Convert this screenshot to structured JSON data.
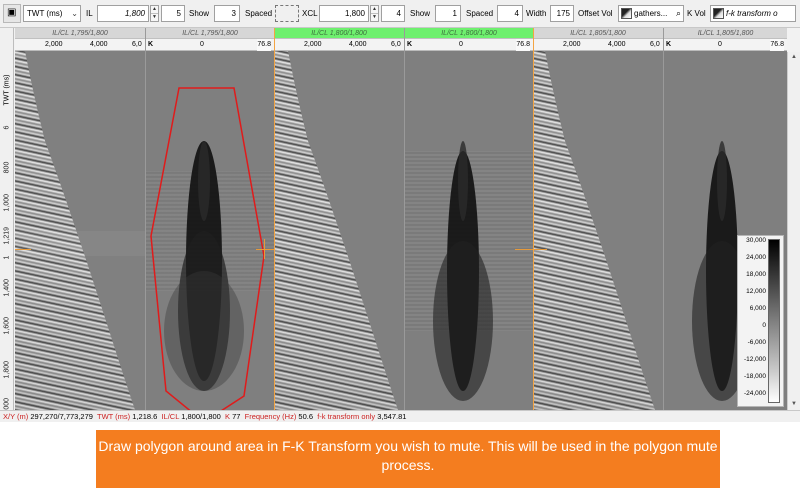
{
  "toolbar": {
    "domain_select": "TWT (ms)",
    "il_label": "IL",
    "il_value": "1,800",
    "il_step": "5",
    "show1_label": "Show",
    "show1_value": "3",
    "spaced1_label": "Spaced",
    "xcl_label": "XCL",
    "xcl_value": "1,800",
    "xcl_step": "4",
    "show2_label": "Show",
    "show2_value": "1",
    "spaced2_label": "Spaced",
    "spaced2_value": "4",
    "width_label": "Width",
    "width_value": "175",
    "offset_vol_label": "Offset Vol",
    "offset_vol_value": "gathers...",
    "k_vol_label": "K Vol",
    "k_vol_value": "f-k transform o"
  },
  "y_axis": {
    "title": "TWT (ms)",
    "ticks": [
      "6",
      "800",
      "1,000",
      "1,219",
      "1",
      "1,400",
      "1,600",
      "1,800",
      "2,000"
    ]
  },
  "panels": [
    {
      "header": "IL/CL 1,795/1,800",
      "ticks": [
        "2,000",
        "4,000",
        "6,0"
      ],
      "kind": "gather"
    },
    {
      "header": "IL/CL 1,795/1,800",
      "k_label": "K",
      "zero": "0",
      "value": "76.8",
      "kind": "fk"
    },
    {
      "header": "IL/CL 1,800/1,800",
      "ticks": [
        "2,000",
        "4,000",
        "6,0"
      ],
      "kind": "gather"
    },
    {
      "header": "IL/CL 1,800/1,800",
      "k_label": "K",
      "zero": "0",
      "value": "76.8",
      "kind": "fk"
    },
    {
      "header": "IL/CL 1,805/1,800",
      "ticks": [
        "2,000",
        "4,000",
        "6,0"
      ],
      "kind": "gather"
    },
    {
      "header": "IL/CL 1,805/1,800",
      "k_label": "K",
      "zero": "0",
      "value": "76.8",
      "kind": "fk"
    }
  ],
  "colorbar": {
    "labels": [
      "30,000",
      "24,000",
      "18,000",
      "12,000",
      "6,000",
      "0",
      "-6,000",
      "-12,000",
      "-18,000",
      "-24,000"
    ]
  },
  "status": {
    "xy_label": "X/Y (m)",
    "xy_value": "297,270/7,773,279",
    "twt_label": "TWT (ms)",
    "twt_value": "1,218.6",
    "ilcl_label": "IL/CL",
    "ilcl_value": "1,800/1,800",
    "k_label": "K",
    "k_value": "77",
    "freq_label": "Frequency (Hz)",
    "freq_value": "50.6",
    "fk_label": "f-k transform only",
    "fk_value": "3,547.81"
  },
  "callout": {
    "text": "Draw polygon around area in F-K Transform you wish to mute. This will be used in the polygon mute process."
  },
  "colors": {
    "callout_bg": "#f47d1f",
    "selected_header": "#6ef06e",
    "polygon": "#e01b1b",
    "cursor": "#e79a3a"
  }
}
